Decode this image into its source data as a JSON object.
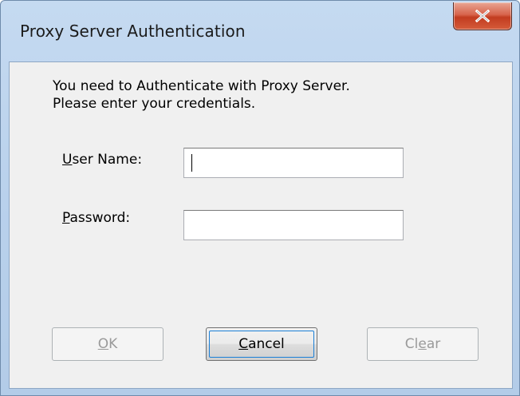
{
  "window": {
    "title": "Proxy Server Authentication",
    "close_icon": "close-x-icon"
  },
  "message": {
    "line1": "You need to Authenticate with Proxy Server.",
    "line2": "Please enter your credentials."
  },
  "form": {
    "username": {
      "label_access": "U",
      "label_rest": "ser Name:",
      "value": ""
    },
    "password": {
      "label_access": "P",
      "label_rest": "assword:",
      "value": ""
    }
  },
  "buttons": {
    "ok": {
      "access": "O",
      "rest": "K",
      "enabled": false
    },
    "cancel": {
      "access": "C",
      "rest": "ancel",
      "enabled": true
    },
    "clear": {
      "pre": "Cl",
      "access": "e",
      "rest": "ar",
      "enabled": false
    }
  },
  "colors": {
    "close_button": "#c94a2e",
    "dialog_face": "#f0f0f0",
    "frame": "#b9d1ec"
  }
}
